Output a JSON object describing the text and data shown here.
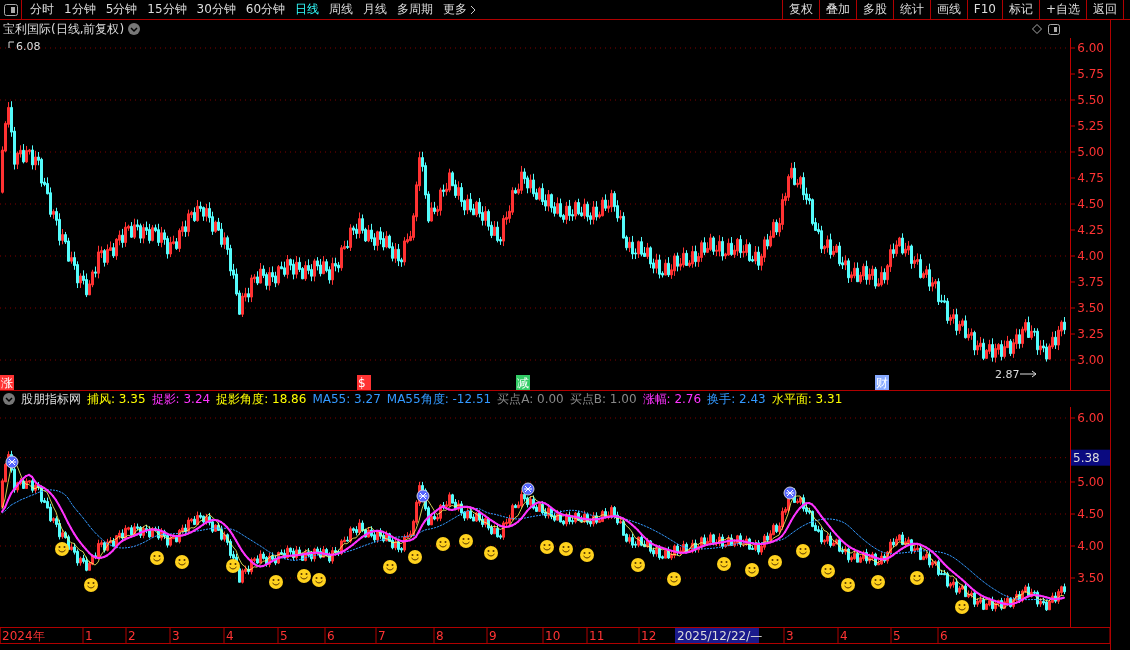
{
  "toolbar": {
    "tabs": [
      {
        "label": "分时",
        "selected": false
      },
      {
        "label": "1分钟",
        "selected": false
      },
      {
        "label": "5分钟",
        "selected": false
      },
      {
        "label": "15分钟",
        "selected": false
      },
      {
        "label": "30分钟",
        "selected": false
      },
      {
        "label": "60分钟",
        "selected": false
      },
      {
        "label": "日线",
        "selected": true
      },
      {
        "label": "周线",
        "selected": false
      },
      {
        "label": "月线",
        "selected": false
      },
      {
        "label": "多周期",
        "selected": false
      },
      {
        "label": "更多",
        "selected": false
      }
    ],
    "buttons": [
      "复权",
      "叠加",
      "多股",
      "统计",
      "画线",
      "F10",
      "标记",
      "+自选",
      "返回"
    ]
  },
  "chart": {
    "title": "宝利国际(日线,前复权)",
    "high_label": "6.08",
    "low_label": "2.87",
    "price_axis": [
      "6.00",
      "5.75",
      "5.50",
      "5.25",
      "5.00",
      "4.75",
      "4.50",
      "4.25",
      "4.00",
      "3.75",
      "3.50",
      "3.25",
      "3.00"
    ],
    "events": [
      {
        "label": "涨",
        "color": "#ff3333"
      },
      {
        "label": "$",
        "color": "#ff3333"
      },
      {
        "label": "减",
        "color": "#33cc66"
      },
      {
        "label": "财",
        "color": "#88aaff"
      }
    ]
  },
  "indicator": {
    "name": "股朋指标网",
    "items": [
      {
        "text": "捕风: 3.35",
        "color": "#ffff00"
      },
      {
        "text": "捉影: 3.24",
        "color": "#ff33ff"
      },
      {
        "text": "捉影角度: 18.86",
        "color": "#ffff00"
      },
      {
        "text": "MA55: 3.27",
        "color": "#3399ff"
      },
      {
        "text": "MA55角度: -12.51",
        "color": "#3399ff"
      },
      {
        "text": "买点A: 0.00",
        "color": "#888888"
      },
      {
        "text": "买点B: 1.00",
        "color": "#888888"
      },
      {
        "text": "涨幅: 2.76",
        "color": "#ff33ff"
      },
      {
        "text": "换手: 2.43",
        "color": "#3399ff"
      },
      {
        "text": "水平面: 3.31",
        "color": "#ffff00"
      }
    ],
    "axis": [
      "6.00",
      "5.00",
      "4.50",
      "4.00",
      "3.50"
    ],
    "current_value": "5.38"
  },
  "date_axis": [
    {
      "label": "2024年",
      "selected": false
    },
    {
      "label": "1",
      "selected": false
    },
    {
      "label": "2",
      "selected": false
    },
    {
      "label": "3",
      "selected": false
    },
    {
      "label": "4",
      "selected": false
    },
    {
      "label": "5",
      "selected": false
    },
    {
      "label": "6",
      "selected": false
    },
    {
      "label": "7",
      "selected": false
    },
    {
      "label": "8",
      "selected": false
    },
    {
      "label": "9",
      "selected": false
    },
    {
      "label": "10",
      "selected": false
    },
    {
      "label": "11",
      "selected": false
    },
    {
      "label": "12",
      "selected": false
    },
    {
      "label": "2025/12/22/—",
      "selected": true
    },
    {
      "label": "3",
      "selected": false
    },
    {
      "label": "4",
      "selected": false
    },
    {
      "label": "5",
      "selected": false
    },
    {
      "label": "6",
      "selected": false
    }
  ]
}
